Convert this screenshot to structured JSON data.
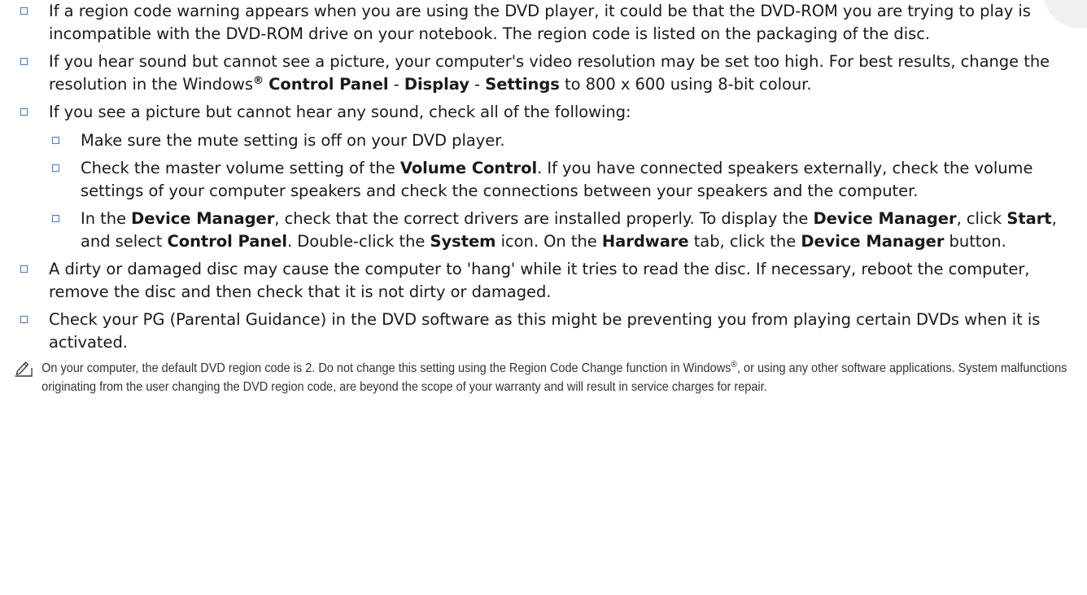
{
  "bullets": [
    {
      "text": "If a region code warning appears when you are using the DVD player, it could be that the DVD-ROM you are trying to play is incompatible with the DVD-ROM drive on your notebook. The region code is listed on the packaging of the disc."
    },
    {
      "pre": "If you hear sound but cannot see a picture, your computer's video resolution may be set too high. For best results, change the resolution in the Windows",
      "reg": "®",
      "kw1": "Control Panel",
      "dash1": " - ",
      "kw2": "Display",
      "dash2": " - ",
      "kw3": "Settings",
      "post": " to 800 x 600 using 8-bit colour."
    },
    {
      "text": "If you see a picture but cannot hear any sound, check all of the following:"
    }
  ],
  "sub_bullets": [
    {
      "text": "Make sure the mute setting is off on your DVD player."
    },
    {
      "pre": "Check the master volume setting of the ",
      "kw1": "Volume Control",
      "post": ". If you have connected speakers externally, check the volume settings of your computer speakers and check the connections between your speakers and the computer."
    },
    {
      "t1": "In the ",
      "k1": "Device Manager",
      "t2": ", check that the correct drivers are installed properly. To display the ",
      "k2": "Device Manager",
      "t3": ", click ",
      "k3": "Start",
      "t4": ", and select ",
      "k4": "Control Panel",
      "t5": ". Double-click the ",
      "k5": "System",
      "t6": " icon. On the ",
      "k6": "Hardware",
      "t7": " tab, click the ",
      "k7": "Device Manager",
      "t8": " button."
    }
  ],
  "bullets_after": [
    {
      "text": "A dirty or damaged disc may cause the computer to 'hang' while it tries to read the disc. If necessary, reboot the computer, remove the disc and then check that it is not dirty or damaged."
    },
    {
      "text": "Check your PG (Parental Guidance) in the DVD software as this might be preventing you from playing certain DVDs when it is activated."
    }
  ],
  "note": {
    "icon": "pencil-note-icon",
    "pre": "On your computer, the default DVD region code is 2. Do not change this setting using the Region Code Change function in Windows",
    "reg": "®",
    "post": ", or using any other software applications. System malfunctions originating from the user changing the DVD region code, are beyond the scope of your warranty and will result in service charges for repair."
  },
  "colors": {
    "bullet_border": "#4a78b8",
    "text": "#1a1a1a"
  }
}
